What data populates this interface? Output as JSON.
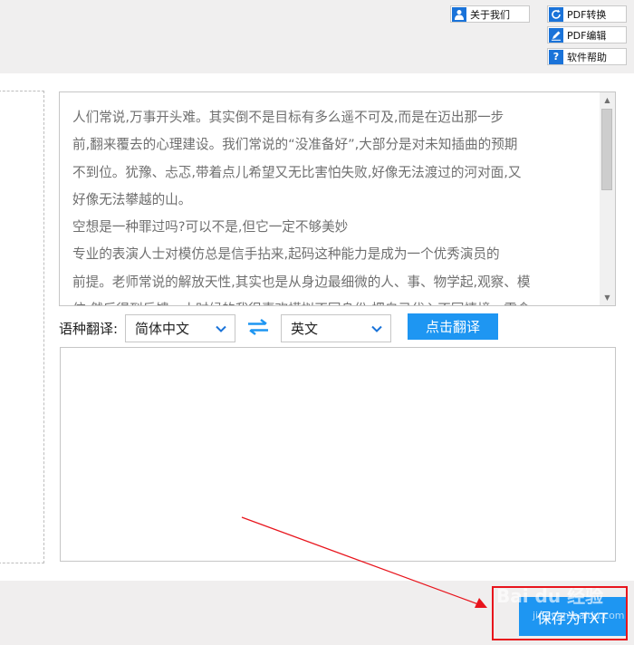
{
  "toolbar": {
    "about_label": "关于我们",
    "pdf_convert_label": "PDF转换",
    "pdf_edit_label": "PDF编辑",
    "help_label": "软件帮助"
  },
  "source": {
    "text": "人们常说,万事开头难。其实倒不是目标有多么遥不可及,而是在迈出那一步\n前,翻来覆去的心理建设。我们常说的“没准备好”,大部分是对未知插曲的预期\n不到位。犹豫、忐忑,带着点儿希望又无比害怕失败,好像无法渡过的河对面,又\n好像无法攀越的山。\n空想是一种罪过吗?可以不是,但它一定不够美妙\n专业的表演人士对模仿总是信手拈来,起码这种能力是成为一个优秀演员的\n前提。老师常说的解放天性,其实也是从身边最细微的人、事、物学起,观察、模\n仿,然后得到反馈。小时候的我很喜欢模拟不同身份,把自己代入不同情境。零食"
  },
  "language": {
    "label": "语种翻译:",
    "from": "简体中文",
    "to": "英文",
    "translate_button": "点击翻译"
  },
  "save_button": "保存为TXT",
  "watermark": {
    "main": "Bai du 经验",
    "sub": "jingyan.baidu.com"
  },
  "colors": {
    "accent": "#1e96f2",
    "highlight": "#e8141c",
    "icon_blue": "#1a73d9"
  }
}
